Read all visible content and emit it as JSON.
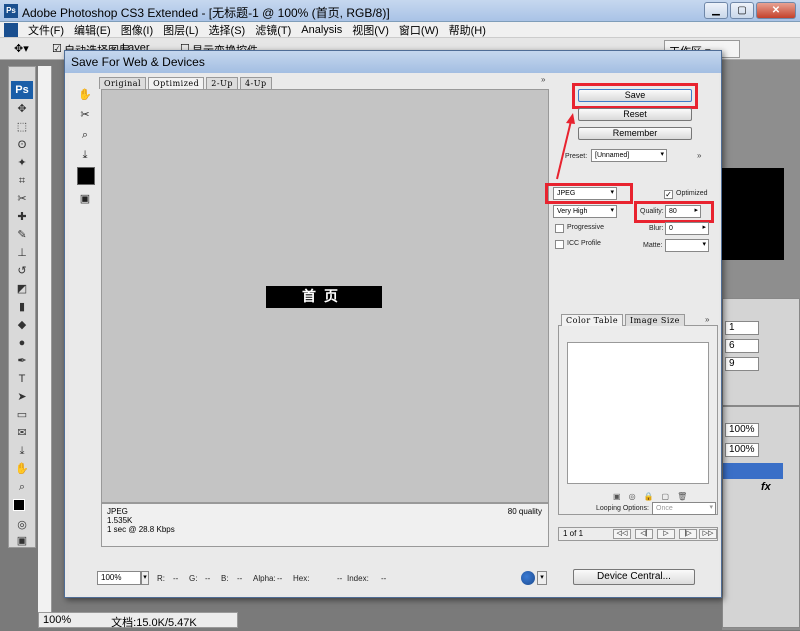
{
  "app": {
    "title": "Adobe Photoshop CS3 Extended - [无标题-1 @ 100% (首页, RGB/8)]",
    "menu": [
      "文件(F)",
      "编辑(E)",
      "图像(I)",
      "图层(L)",
      "选择(S)",
      "滤镜(T)",
      "Analysis",
      "视图(V)",
      "窗口(W)",
      "帮助(H)"
    ],
    "options": {
      "auto_select": "自动选择图层",
      "layer": "Layer",
      "transform": "显示变换控件",
      "workspace": "工作区"
    },
    "status": {
      "zoom": "100%",
      "doc": "文档:15.0K/5.47K"
    }
  },
  "right_panel": {
    "fields": [
      "1",
      "6",
      "9"
    ],
    "zoom1": "100%",
    "zoom2": "100%",
    "fx": "fx"
  },
  "dialog": {
    "title": "Save For Web & Devices",
    "tabs": [
      "Original",
      "Optimized",
      "2-Up",
      "4-Up"
    ],
    "active_tab": "Optimized",
    "banner_text": "首页",
    "info": {
      "format": "JPEG",
      "size": "1.535K",
      "speed": "1 sec @ 28.8 Kbps",
      "quality": "80 quality"
    },
    "buttons": {
      "save": "Save",
      "reset": "Reset",
      "remember": "Remember",
      "device_central": "Device Central..."
    },
    "preset_label": "Preset:",
    "preset_value": "[Unnamed]",
    "format": "JPEG",
    "optimized_label": "Optimized",
    "quality_level": "Very High",
    "quality_label": "Quality:",
    "quality_value": "80",
    "progressive_label": "Progressive",
    "blur_label": "Blur:",
    "blur_value": "0",
    "icc_label": "ICC Profile",
    "matte_label": "Matte:",
    "color_tabs": [
      "Color Table",
      "Image Size"
    ],
    "looping_label": "Looping Options:",
    "looping_value": "Once",
    "pager": "1 of 1",
    "bottom": {
      "zoom": "100%",
      "r": "R:",
      "r_val": "--",
      "g": "G:",
      "g_val": "--",
      "b": "B:",
      "b_val": "--",
      "alpha": "Alpha:",
      "alpha_val": "--",
      "hex": "Hex:",
      "hex_val": "--",
      "index": "Index:",
      "index_val": "--"
    }
  },
  "colors": {
    "highlight": "#e8232f",
    "banner_bg": "#000000",
    "canvas_bg": "#c4c4c4"
  }
}
